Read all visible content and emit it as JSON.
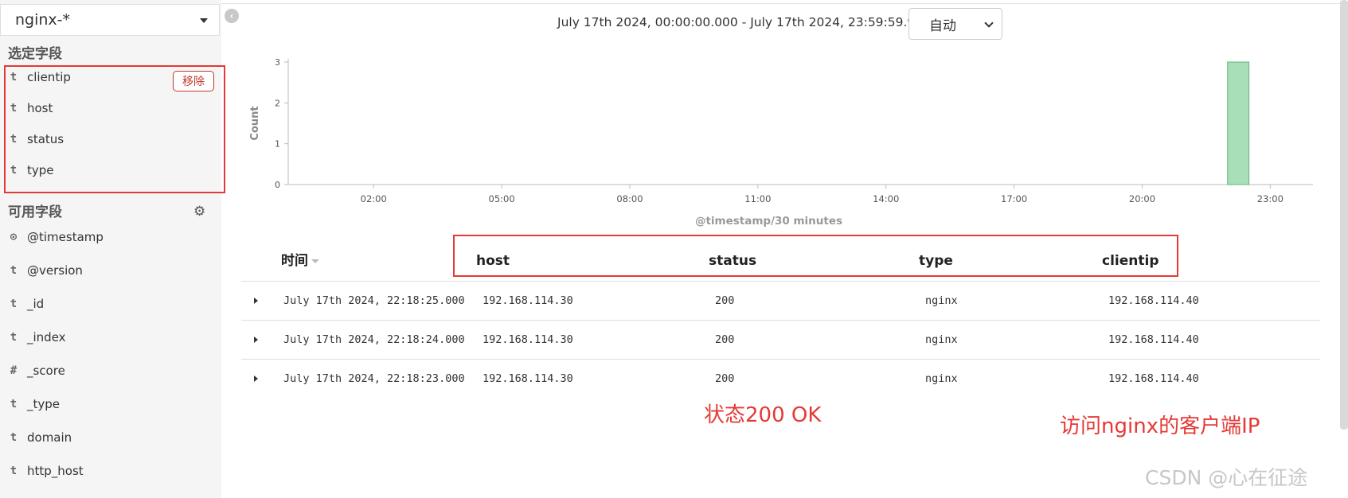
{
  "sidebar": {
    "index_pattern": "nginx-*",
    "selected_title": "选定字段",
    "selected_fields": [
      {
        "type": "t",
        "name": "clientip"
      },
      {
        "type": "t",
        "name": "host"
      },
      {
        "type": "t",
        "name": "status"
      },
      {
        "type": "t",
        "name": "type"
      }
    ],
    "remove_label": "移除",
    "available_title": "可用字段",
    "available_fields": [
      {
        "type": "⊙",
        "name": "@timestamp"
      },
      {
        "type": "t",
        "name": "@version"
      },
      {
        "type": "t",
        "name": "_id"
      },
      {
        "type": "t",
        "name": "_index"
      },
      {
        "type": "#",
        "name": "_score"
      },
      {
        "type": "t",
        "name": "_type"
      },
      {
        "type": "t",
        "name": "domain"
      },
      {
        "type": "t",
        "name": "http_host"
      }
    ]
  },
  "timebar": {
    "range": "July 17th 2024, 00:00:00.000 - July 17th 2024, 23:59:59.999 —",
    "interval": "自动"
  },
  "chart_data": {
    "type": "bar",
    "ylabel": "Count",
    "xlabel": "@timestamp/30 minutes",
    "x_ticks": [
      "02:00",
      "05:00",
      "08:00",
      "11:00",
      "14:00",
      "17:00",
      "20:00",
      "23:00"
    ],
    "y_ticks": [
      "0",
      "1",
      "2",
      "3"
    ],
    "ylim": [
      0,
      3
    ],
    "xlim_hours": [
      0,
      24
    ],
    "bars": [
      {
        "start_hour": 22.0,
        "end_hour": 22.5,
        "value": 3
      }
    ],
    "bar_color": "#a8dfb8",
    "grid": false
  },
  "table": {
    "columns": [
      "时间",
      "host",
      "status",
      "type",
      "clientip"
    ],
    "rows": [
      {
        "time": "July 17th 2024, 22:18:25.000",
        "host": "192.168.114.30",
        "status": "200",
        "type": "nginx",
        "clientip": "192.168.114.40"
      },
      {
        "time": "July 17th 2024, 22:18:24.000",
        "host": "192.168.114.30",
        "status": "200",
        "type": "nginx",
        "clientip": "192.168.114.40"
      },
      {
        "time": "July 17th 2024, 22:18:23.000",
        "host": "192.168.114.30",
        "status": "200",
        "type": "nginx",
        "clientip": "192.168.114.40"
      }
    ]
  },
  "annotations": {
    "status_note": "状态200 OK",
    "clientip_note": "访问nginx的客户端IP"
  },
  "watermark": "CSDN @心在征途",
  "colors": {
    "annotation_red": "#e53935",
    "bar_green": "#a8dfb8"
  }
}
